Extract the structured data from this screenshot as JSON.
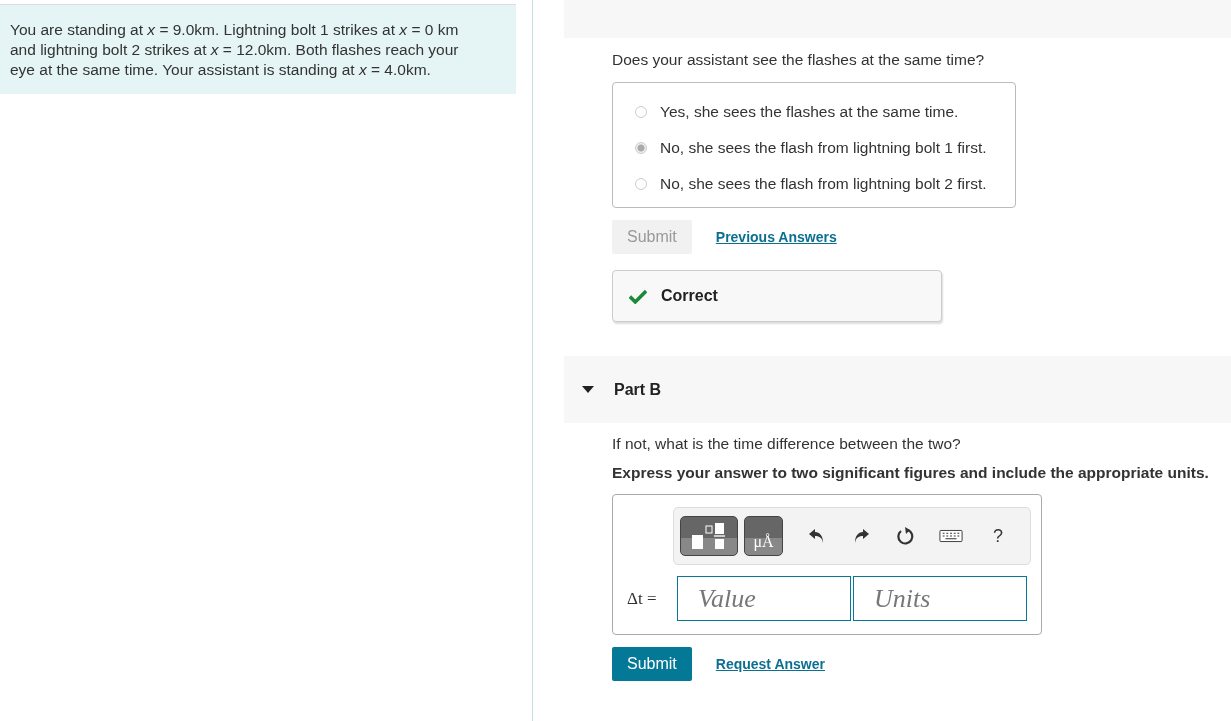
{
  "problem": {
    "text": "You are standing at *x* = 9.0km. Lightning bolt 1 strikes at *x* = 0 km and lightning bolt 2 strikes at *x* = 12.0km. Both flashes reach your eye at the same time. Your assistant is standing at *x* = 4.0km."
  },
  "part_a": {
    "question": "Does your assistant see the flashes at the same time?",
    "options": [
      {
        "label": "Yes, she sees the flashes at the same time.",
        "selected": false
      },
      {
        "label": "No, she sees the flash from lightning bolt 1 first.",
        "selected": true
      },
      {
        "label": "No, she sees the flash from lightning bolt 2 first.",
        "selected": false
      }
    ],
    "submit": {
      "label": "Submit",
      "disabled": true
    },
    "link": "Previous Answers",
    "feedback": {
      "kind": "correct",
      "text": "Correct"
    }
  },
  "part_b": {
    "title": "Part B",
    "expanded": true,
    "question": "If not, what is the time difference between the two?",
    "instruction": "Express your answer to two significant figures and include the appropriate units.",
    "toolbar": {
      "units_label": "μÅ",
      "help": "?"
    },
    "variable": "Δt =",
    "value_placeholder": "Value",
    "units_placeholder": "Units",
    "submit": {
      "label": "Submit",
      "disabled": false
    },
    "link": "Request Answer"
  }
}
